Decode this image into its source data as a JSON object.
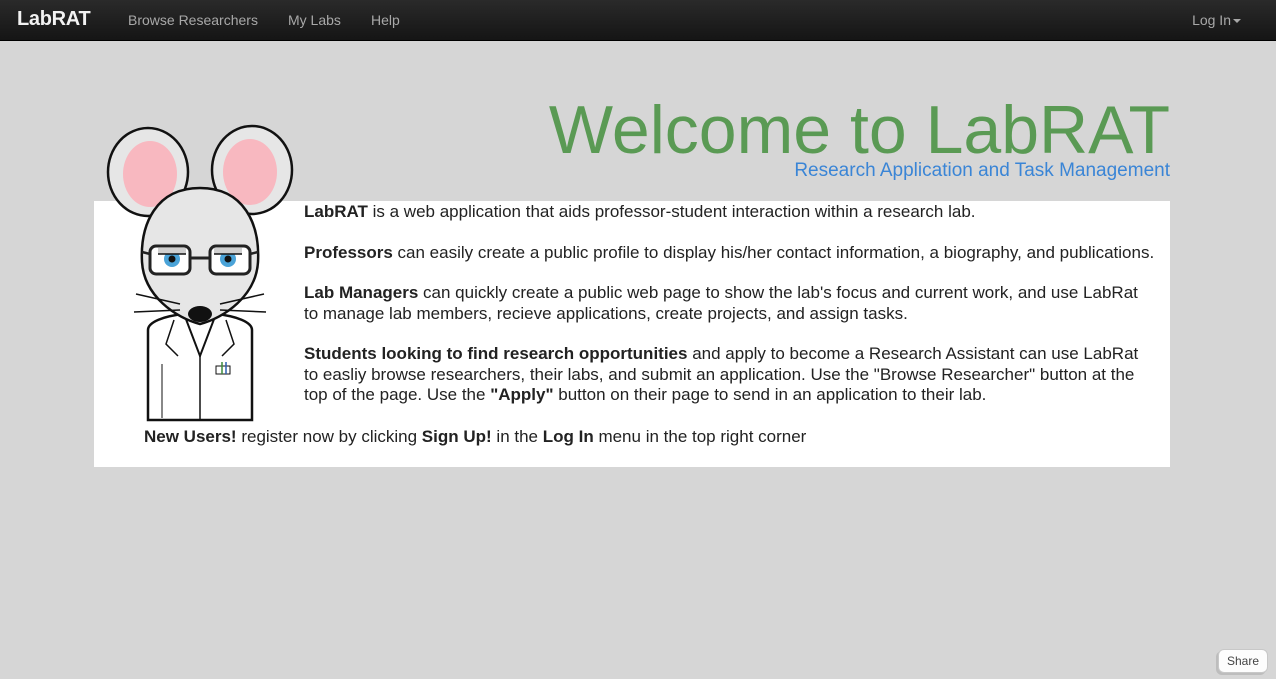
{
  "navbar": {
    "brand": "LabRAT",
    "links": [
      "Browse Researchers",
      "My Labs",
      "Help"
    ],
    "login": "Log In"
  },
  "hero": {
    "title": "Welcome to LabRAT",
    "subtitle": "Research Application and Task Management"
  },
  "content": {
    "p1": {
      "bold": "LabRAT",
      "rest": " is a web application that aids professor-student interaction within a research lab."
    },
    "p2": {
      "bold": "Professors",
      "rest": " can easily create a public profile to display his/her contact information, a biography, and publications."
    },
    "p3": {
      "bold": "Lab Managers",
      "rest": " can quickly create a public web page to show the lab's focus and current work, and use LabRat to manage lab members, recieve applications, create projects, and assign tasks."
    },
    "p4": {
      "bold": "Students looking to find research opportunities",
      "rest": " and apply to become a Research Assistant can use LabRat to easliy browse researchers, their labs, and submit an application. Use the \"Browse Researcher\" button at the top of the page. Use the ",
      "apply": "\"Apply\"",
      "rest2": " button on their page to send in an application to their lab."
    },
    "newusers": {
      "bold1": "New Users!",
      "text1": " register now by clicking ",
      "bold2": "Sign Up!",
      "text2": " in the ",
      "bold3": "Log In",
      "text3": " menu in the top right corner"
    }
  },
  "share": "Share",
  "colors": {
    "title": "#5a9a54",
    "subtitle": "#3a85d6",
    "navbar": "#1b1b1b",
    "background": "#d6d6d6"
  },
  "icons": {
    "mascot": "lab-rat-mascot",
    "login_caret": "caret-down-icon"
  }
}
